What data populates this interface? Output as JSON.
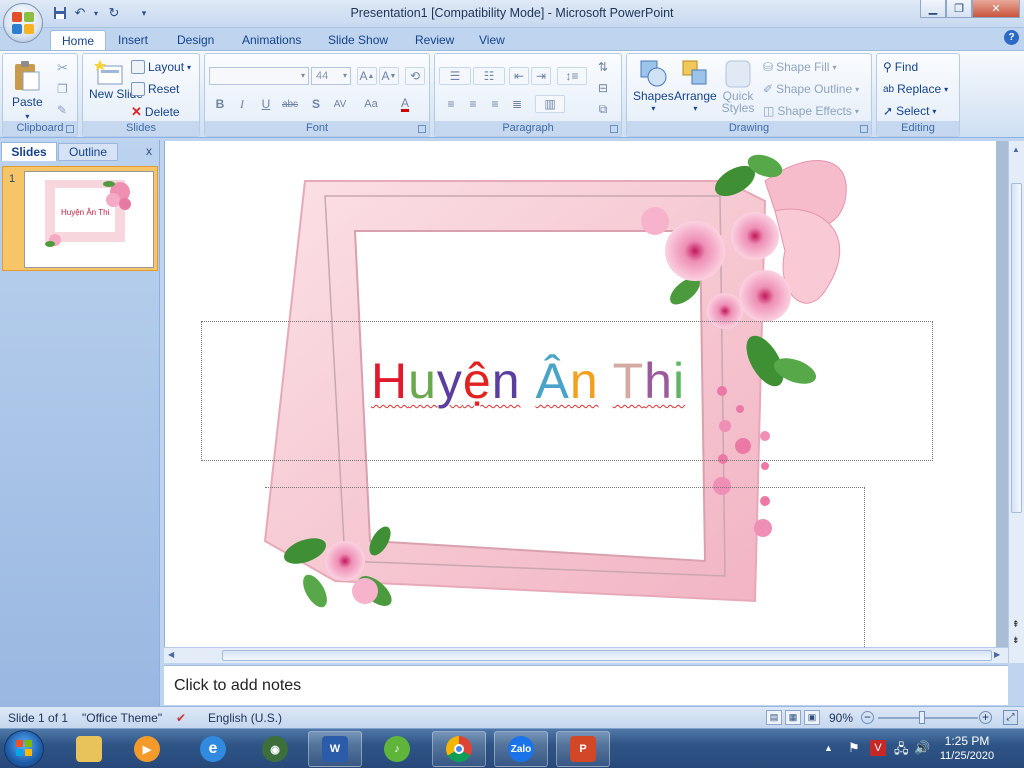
{
  "window": {
    "title": "Presentation1 [Compatibility Mode] - Microsoft PowerPoint"
  },
  "tabs": [
    "Home",
    "Insert",
    "Design",
    "Animations",
    "Slide Show",
    "Review",
    "View"
  ],
  "ribbon": {
    "clipboard": {
      "paste": "Paste",
      "label": "Clipboard"
    },
    "slides": {
      "new_slide": "New Slide",
      "layout": "Layout",
      "reset": "Reset",
      "delete": "Delete",
      "label": "Slides"
    },
    "font": {
      "font_name": "",
      "font_size": "44",
      "label": "Font"
    },
    "paragraph": {
      "label": "Paragraph"
    },
    "drawing": {
      "shapes": "Shapes",
      "arrange": "Arrange",
      "quick_styles": "Quick Styles",
      "shape_fill": "Shape Fill",
      "shape_outline": "Shape Outline",
      "shape_effects": "Shape Effects",
      "label": "Drawing"
    },
    "editing": {
      "find": "Find",
      "replace": "Replace",
      "select": "Select",
      "label": "Editing"
    }
  },
  "left_panel": {
    "tab_slides": "Slides",
    "tab_outline": "Outline",
    "close": "x",
    "thumb_number": "1",
    "thumb_text": "Huyện Ân Thi"
  },
  "slide": {
    "title_parts": [
      {
        "text": "H",
        "color": "#e01a2c"
      },
      {
        "text": "u",
        "color": "#6aa84f"
      },
      {
        "text": "y",
        "color": "#5b3fa0"
      },
      {
        "text": "ệ",
        "color": "#e0231f"
      },
      {
        "text": "n",
        "color": "#5b3fa0"
      },
      {
        "text": " ",
        "color": "#000000"
      },
      {
        "text": "Â",
        "color": "#4aa3c8"
      },
      {
        "text": "n",
        "color": "#f2a11f"
      },
      {
        "text": " ",
        "color": "#000000"
      },
      {
        "text": "T",
        "color": "#d6aaa4"
      },
      {
        "text": "h",
        "color": "#9b5a9b"
      },
      {
        "text": "i",
        "color": "#5fb563"
      }
    ]
  },
  "notes": {
    "placeholder": "Click to add notes"
  },
  "statusbar": {
    "slide_info": "Slide 1 of 1",
    "theme": "\"Office Theme\"",
    "language": "English (U.S.)",
    "zoom": "90%",
    "zoom_level_percent": 90
  },
  "taskbar": {
    "apps": [
      "file-explorer",
      "media-player",
      "internet-explorer",
      "media-center",
      "word",
      "music",
      "chrome",
      "zalo",
      "powerpoint"
    ],
    "zalo_label": "Zalo",
    "time": "1:25 PM",
    "date": "11/25/2020"
  }
}
